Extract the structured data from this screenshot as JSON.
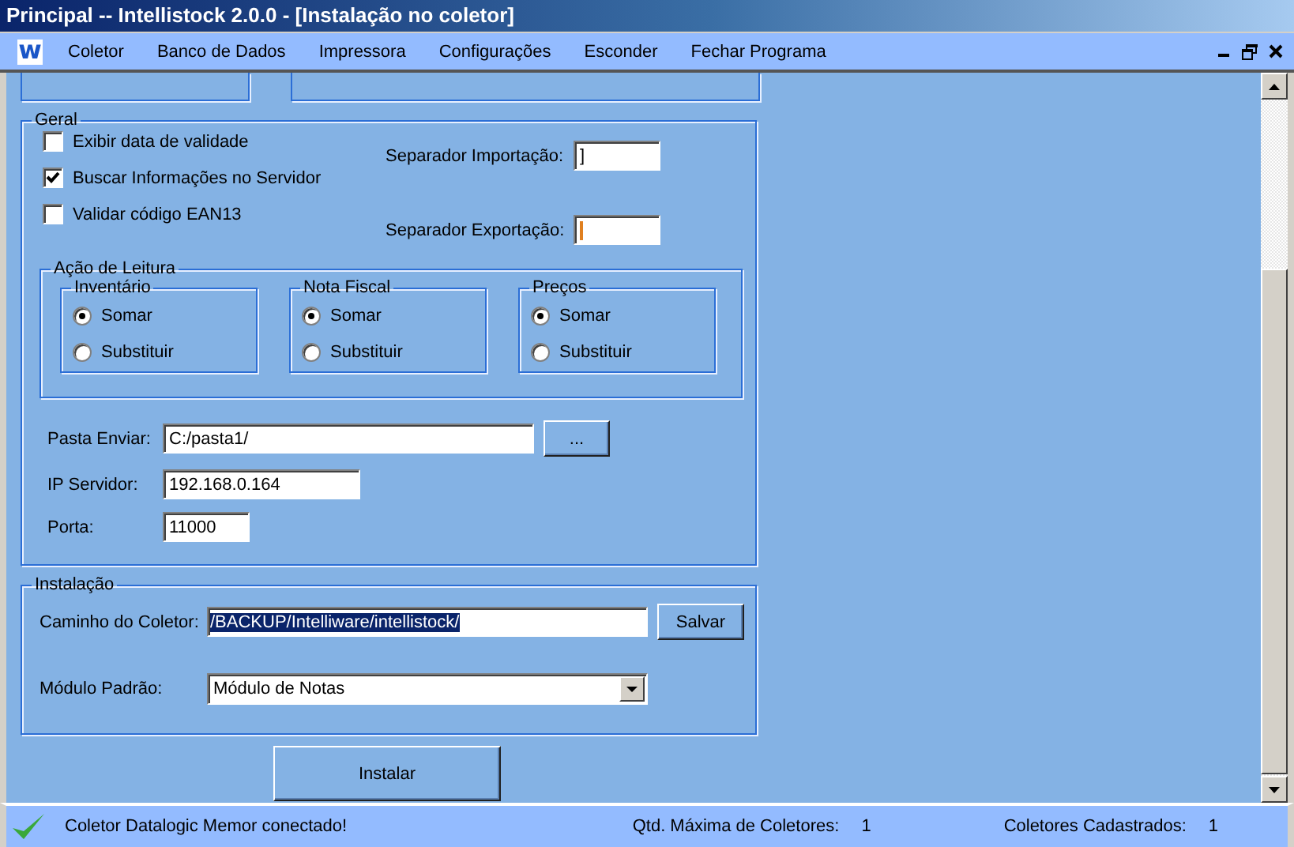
{
  "window": {
    "title": "Principal -- Intellistock 2.0.0 - [Instalação no coletor]"
  },
  "menu_bar": {
    "logo": "w",
    "items": [
      "Coletor",
      "Banco de Dados",
      "Impressora",
      "Configurações",
      "Esconder",
      "Fechar Programa"
    ]
  },
  "geral": {
    "title": "Geral",
    "checkboxes": [
      {
        "label": "Exibir data de validade",
        "checked": false
      },
      {
        "label": "Buscar Informações no Servidor",
        "checked": true
      },
      {
        "label": "Validar código EAN13",
        "checked": false
      }
    ],
    "separators": [
      {
        "label": "Separador Importação:",
        "value": "]",
        "focused": false
      },
      {
        "label": "Separador Exportação:",
        "focused": true
      }
    ],
    "acao_leitura": {
      "title": "Ação de Leitura",
      "groups": [
        {
          "title": "Inventário",
          "options": [
            {
              "label": "Somar",
              "selected": true
            },
            {
              "label": "Substituir",
              "selected": false
            }
          ]
        },
        {
          "title": "Nota Fiscal",
          "options": [
            {
              "label": "Somar",
              "selected": true
            },
            {
              "label": "Substituir",
              "selected": false
            }
          ]
        },
        {
          "title": "Preços",
          "options": [
            {
              "label": "Somar",
              "selected": true
            },
            {
              "label": "Substituir",
              "selected": false
            }
          ]
        }
      ]
    },
    "fields": [
      {
        "kind": "browse",
        "label": "Pasta Enviar:",
        "value": "C:/pasta1/",
        "button": "..."
      },
      {
        "kind": "text",
        "label": "IP Servidor:",
        "value": "192.168.0.164"
      },
      {
        "kind": "text",
        "label": "Porta:",
        "value": "11000"
      }
    ]
  },
  "instalacao": {
    "title": "Instalação",
    "caminho": {
      "label": "Caminho do Coletor:",
      "value": "/BACKUP/Intelliware/intellistock/",
      "text_selected": true,
      "button": "Salvar"
    },
    "modulo": {
      "label": "Módulo Padrão:",
      "value": "Módulo de Notas"
    }
  },
  "install_button": "Instalar",
  "status_bar": {
    "message": "Coletor Datalogic Memor conectado!",
    "max_label": "Qtd. Máxima de Coletores:",
    "max_value": "1",
    "registered_label": "Coletores Cadastrados:",
    "registered_value": "1"
  }
}
